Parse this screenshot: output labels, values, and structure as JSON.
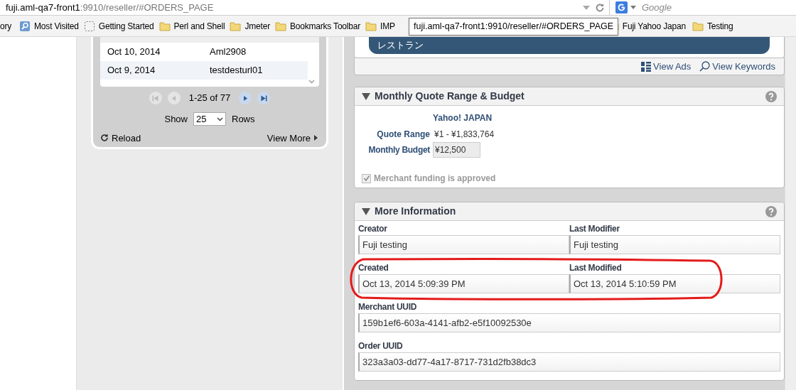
{
  "address_bar": {
    "host": "fuji.aml-qa7-front1",
    "path": ":9910/reseller/#ORDERS_PAGE"
  },
  "search": {
    "placeholder": "Google"
  },
  "bookmarks": [
    {
      "label": "ory",
      "kind": "plain"
    },
    {
      "label": "Most Visited",
      "kind": "smart"
    },
    {
      "label": "Getting Started",
      "kind": "page"
    },
    {
      "label": "Perl and Shell",
      "kind": "folder"
    },
    {
      "label": "Jmeter",
      "kind": "folder"
    },
    {
      "label": "Bookmarks Toolbar",
      "kind": "folder"
    },
    {
      "label": "IMP",
      "kind": "folder"
    },
    {
      "label": "Fuji Yahoo Japan",
      "kind": "folder"
    },
    {
      "label": "Testing",
      "kind": "folder"
    }
  ],
  "tooltip": "fuji.aml-qa7-front1:9910/reseller/#ORDERS_PAGE",
  "orders_list": {
    "rows": [
      {
        "date": "Oct 10, 2014",
        "name": "Aml2908"
      },
      {
        "date": "Oct 9, 2014",
        "name": "testdesturl01"
      }
    ],
    "pager_buttons": [
      {
        "kind": "first",
        "disabled": true
      },
      {
        "kind": "prev",
        "disabled": true
      },
      {
        "kind": "next",
        "disabled": false
      },
      {
        "kind": "last",
        "disabled": false
      }
    ],
    "pager_text": "1-25 of 77",
    "show_label": "Show",
    "rows_value": "25",
    "rows_label": "Rows",
    "reload": "Reload",
    "view_more": "View More"
  },
  "category_pill": "レストラン",
  "links": [
    {
      "label": "View Ads",
      "kind": "grid"
    },
    {
      "label": "View Keywords",
      "kind": "search"
    }
  ],
  "quote_panel": {
    "title": "Monthly Quote Range & Budget",
    "expanded": true,
    "column_header": "Yahoo! JAPAN",
    "quote_range_label": "Quote Range",
    "quote_range": "¥1 - ¥1,833,764",
    "budget_label": "Monthly Budget",
    "budget_value": "¥12,500",
    "merchant_funding": {
      "label": "Merchant funding is approved",
      "checked": true,
      "disabled": true
    }
  },
  "info_panel": {
    "title": "More Information",
    "expanded": true,
    "fields": [
      {
        "label": "Creator",
        "value": "Fuji testing",
        "kind": "half"
      },
      {
        "label": "Last Modifier",
        "value": "Fuji testing",
        "kind": "half"
      },
      {
        "label": "Created",
        "value": "Oct 13, 2014 5:09:39 PM",
        "kind": "half"
      },
      {
        "label": "Last Modified",
        "value": "Oct 13, 2014 5:10:59 PM",
        "kind": "half"
      },
      {
        "label": "Merchant UUID",
        "value": "159b1ef6-603a-4141-afb2-e5f10092530e",
        "kind": "full"
      },
      {
        "label": "Order UUID",
        "value": "323a3a03-dd77-4a17-8717-731d2fb38dc3",
        "kind": "full"
      }
    ]
  }
}
